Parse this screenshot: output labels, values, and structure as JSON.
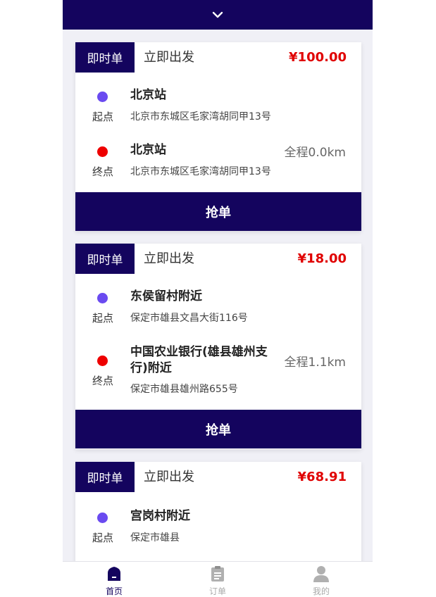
{
  "header": {
    "collapse_icon": "chevron-down-icon",
    "background": "#14045e"
  },
  "orders": [
    {
      "badge": "即时单",
      "depart": "立即出发",
      "price": "¥100.00",
      "start_tag": "起点",
      "start_name": "北京站",
      "start_addr": "北京市东城区毛家湾胡同甲13号",
      "end_tag": "终点",
      "end_name": "北京站",
      "end_addr": "北京市东城区毛家湾胡同甲13号",
      "distance": "全程0.0km",
      "action": "抢单"
    },
    {
      "badge": "即时单",
      "depart": "立即出发",
      "price": "¥18.00",
      "start_tag": "起点",
      "start_name": "东侯留村附近",
      "start_addr": "保定市雄县文昌大街116号",
      "end_tag": "终点",
      "end_name": "中国农业银行(雄县雄州支行)附近",
      "end_addr": "保定市雄县雄州路655号",
      "distance": "全程1.1km",
      "action": "抢单"
    },
    {
      "badge": "即时单",
      "depart": "立即出发",
      "price": "¥68.91",
      "start_tag": "起点",
      "start_name": "宫岗村附近",
      "start_addr": "保定市雄县"
    }
  ],
  "nav": {
    "items": [
      {
        "label": "首页",
        "icon": "home-icon",
        "active": true
      },
      {
        "label": "订单",
        "icon": "clipboard-icon",
        "active": false
      },
      {
        "label": "我的",
        "icon": "user-icon",
        "active": false
      }
    ]
  },
  "colors": {
    "primary": "#14045e",
    "price": "#e00000",
    "start_dot": "#6a4af0",
    "end_dot": "#ee0000",
    "nav_inactive": "#aaaaaa"
  }
}
